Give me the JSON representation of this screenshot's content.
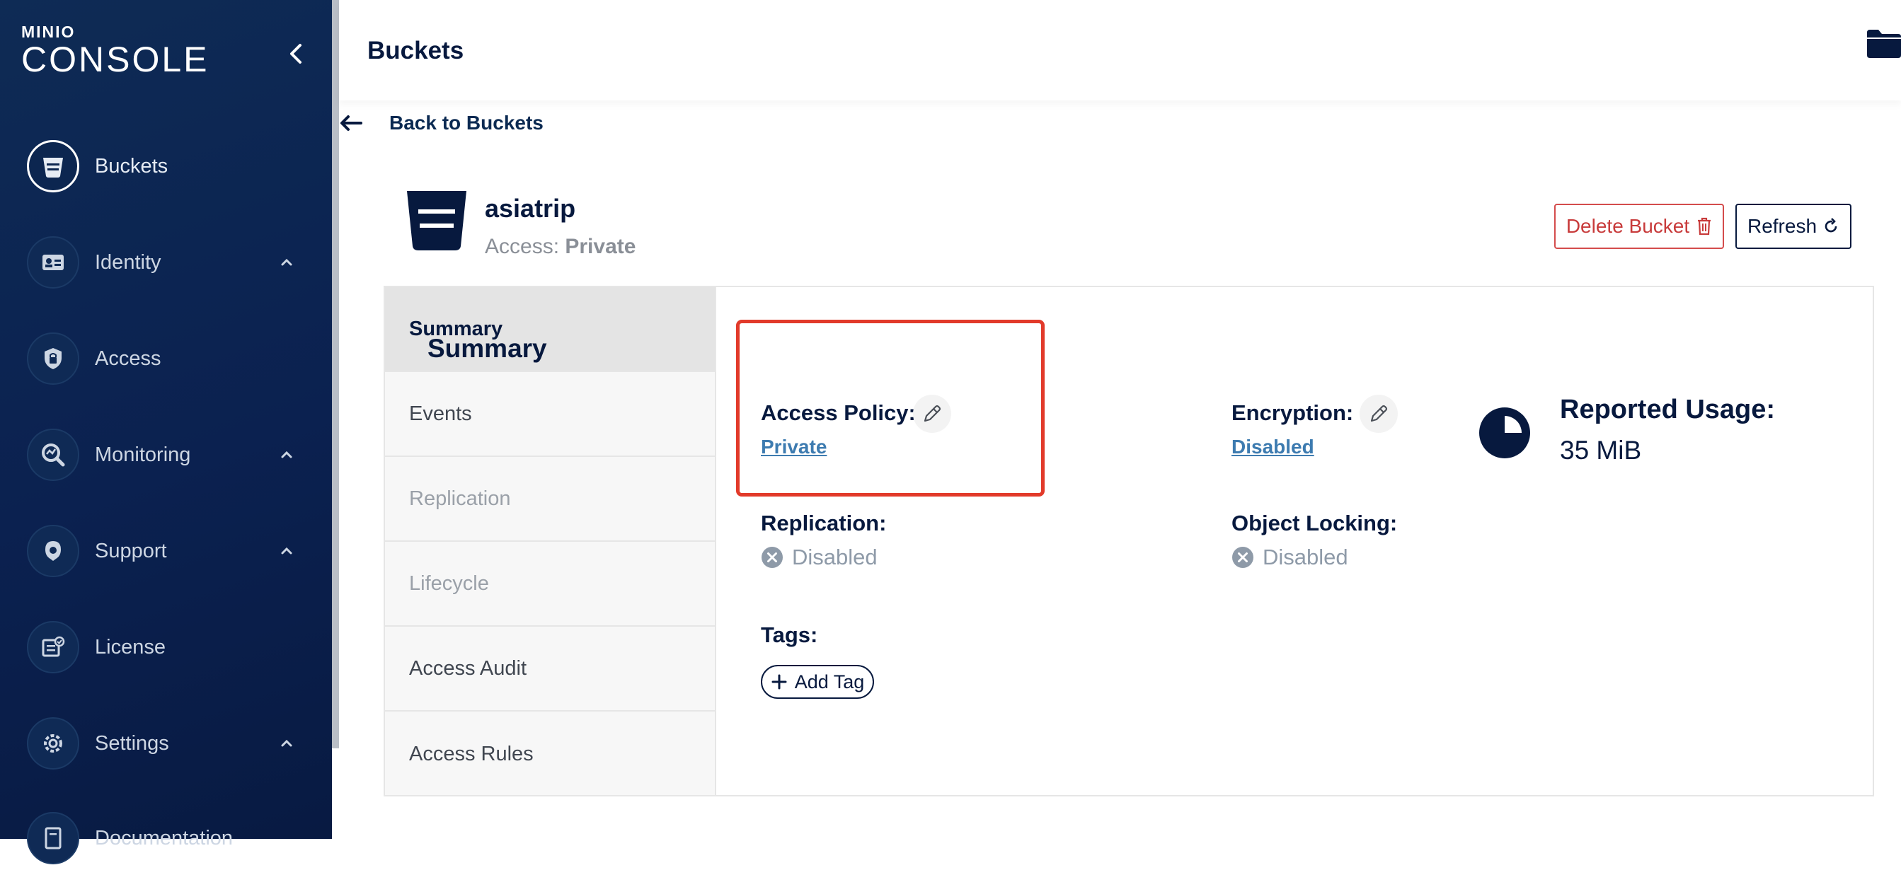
{
  "app": {
    "brand": "MINIO",
    "product": "CONSOLE"
  },
  "sidebar": {
    "items": [
      {
        "label": "Buckets",
        "icon": "bucket-icon",
        "active": true
      },
      {
        "label": "Identity",
        "icon": "id-card-icon",
        "expandable": true
      },
      {
        "label": "Access",
        "icon": "lock-shield-icon"
      },
      {
        "label": "Monitoring",
        "icon": "magnifier-chart-icon",
        "expandable": true
      },
      {
        "label": "Support",
        "icon": "support-icon",
        "expandable": true
      },
      {
        "label": "License",
        "icon": "license-icon"
      },
      {
        "label": "Settings",
        "icon": "gear-icon",
        "expandable": true
      },
      {
        "label": "Documentation",
        "icon": "document-icon"
      }
    ]
  },
  "header": {
    "title": "Buckets"
  },
  "back": {
    "label": "Back to Buckets"
  },
  "bucket": {
    "name": "asiatrip",
    "access_prefix": "Access:",
    "access_value": "Private",
    "delete_label": "Delete Bucket",
    "refresh_label": "Refresh"
  },
  "tabs": [
    {
      "label": "Summary",
      "state": "active"
    },
    {
      "label": "Events",
      "state": "enabled"
    },
    {
      "label": "Replication",
      "state": "disabled"
    },
    {
      "label": "Lifecycle",
      "state": "disabled"
    },
    {
      "label": "Access Audit",
      "state": "enabled"
    },
    {
      "label": "Access Rules",
      "state": "enabled"
    }
  ],
  "summary": {
    "title": "Summary",
    "access_policy_label": "Access Policy:",
    "access_policy_value": "Private",
    "encryption_label": "Encryption:",
    "encryption_value": "Disabled",
    "usage_label": "Reported Usage:",
    "usage_value": "35 MiB",
    "replication_label": "Replication:",
    "replication_value": "Disabled",
    "object_locking_label": "Object Locking:",
    "object_locking_value": "Disabled",
    "tags_label": "Tags:",
    "add_tag_label": "Add Tag"
  },
  "colors": {
    "sidebar_bg": "#0b2150",
    "primary": "#07193e",
    "link": "#3d7bb0",
    "danger": "#c83b3b",
    "highlight": "#e23a2a",
    "muted": "#8e9aa8"
  }
}
